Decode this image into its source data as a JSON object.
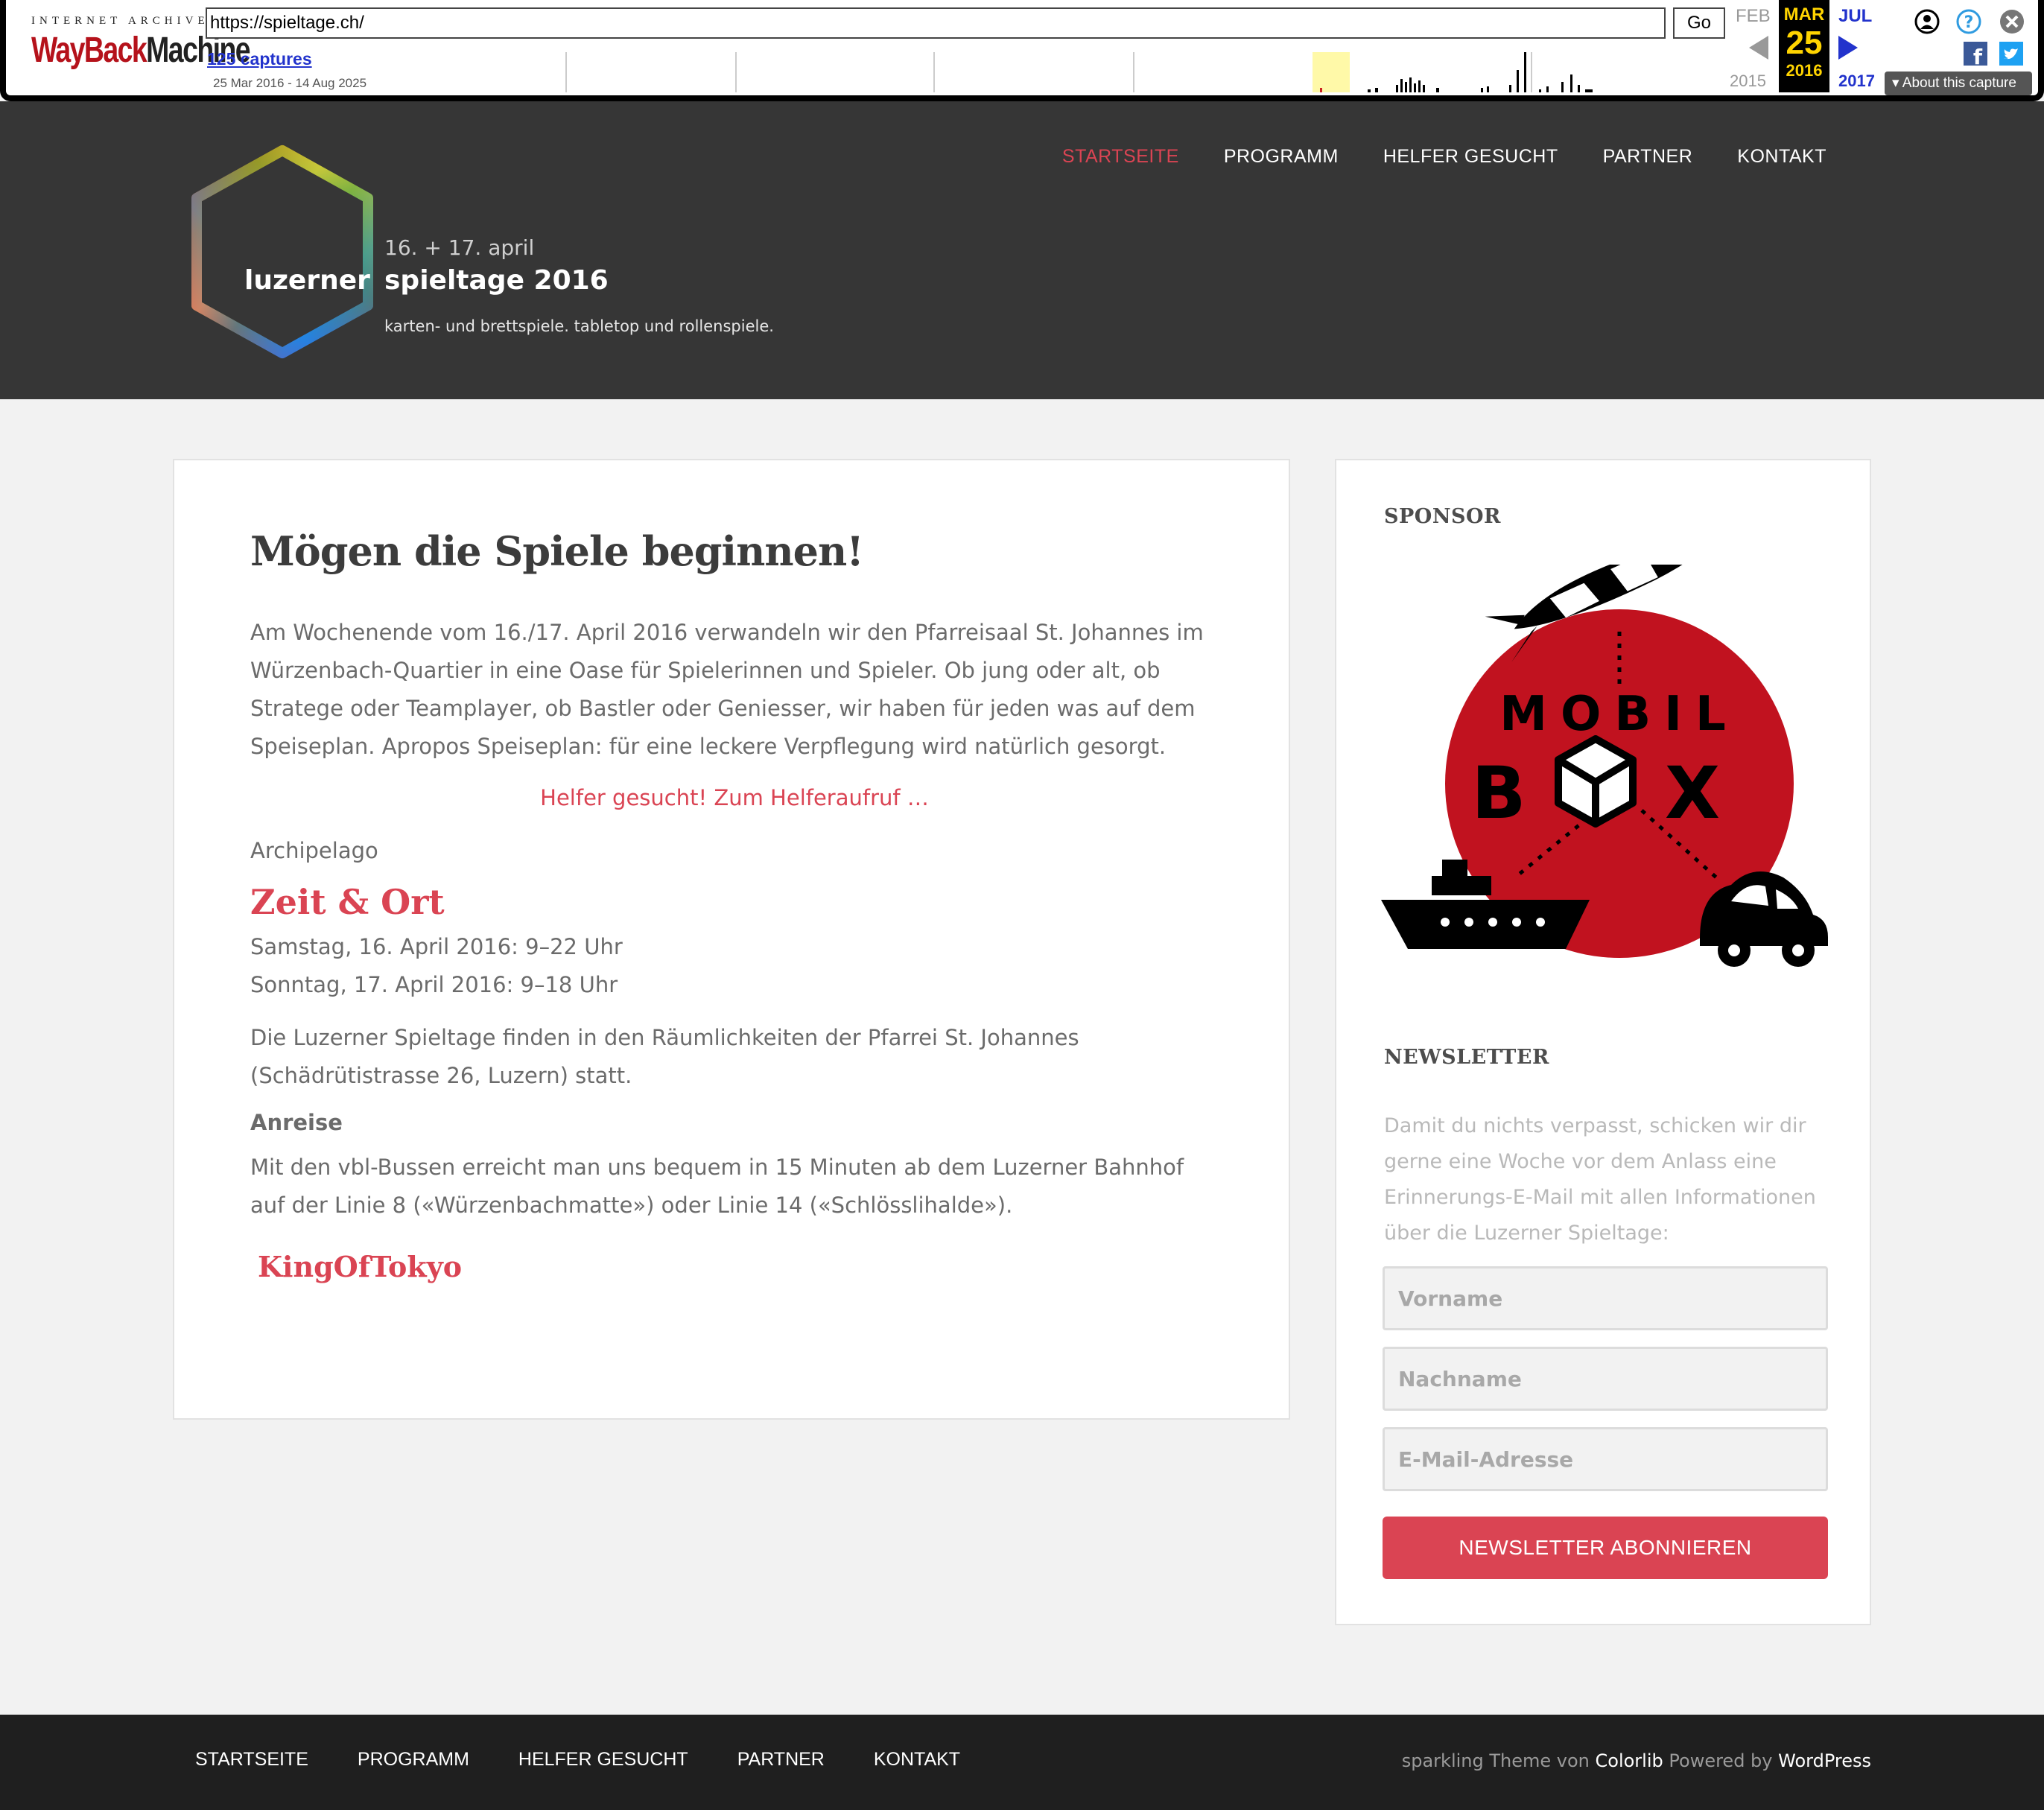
{
  "wayback": {
    "logo_top": "INTERNET ARCHIVE",
    "logo_way": "WayBack",
    "logo_machine": "Machine",
    "url": "https://spieltage.ch/",
    "go_label": "Go",
    "captures": "125 captures",
    "date_range": "25 Mar 2016 - 14 Aug 2025",
    "prev_month": "FEB",
    "cur_month": "MAR",
    "cur_day": "25",
    "cur_year": "2016",
    "next_month": "JUL",
    "prev_year": "2015",
    "next_year": "2017",
    "about": "About this capture",
    "icons": [
      "user-icon",
      "help-icon",
      "close-icon",
      "facebook-icon",
      "twitter-icon"
    ]
  },
  "header": {
    "logo": {
      "dates": "16. + 17. april",
      "word_left": "luzerner",
      "word_right": "spieltage 2016",
      "tagline": "karten- und brettspiele. tabletop und rollenspiele."
    },
    "nav": [
      "STARTSEITE",
      "PROGRAMM",
      "HELFER GESUCHT",
      "PARTNER",
      "KONTAKT"
    ],
    "active_index": 0
  },
  "main": {
    "title": "Mögen die Spiele beginnen!",
    "intro": "Am Wochenende vom 16./17. April 2016 verwandeln wir den Pfarreisaal St. Johannes im Würzenbach-Quartier in eine Oase für Spielerinnen und Spieler. Ob jung oder alt, ob Stratege oder Teamplayer, ob Bastler oder Geniesser, wir haben für jeden was auf dem Speiseplan. Apropos Speiseplan: für eine leckere Verpflegung wird natürlich gesorgt.",
    "helper_link": "Helfer gesucht! Zum Helferaufruf …",
    "archipelago": "Archipelago",
    "time_place_heading": "Zeit & Ort",
    "saturday": "Samstag, 16. April 2016: 9–22 Uhr",
    "sunday": "Sonntag, 17. April 2016: 9–18 Uhr",
    "location": "Die Luzerner Spieltage finden in den Räumlichkeiten der Pfarrei St. Johannes (Schädrütistrasse 26, Luzern) statt.",
    "travel_heading": "Anreise",
    "travel": "Mit den vbl-Bussen erreicht man uns bequem in 15 Minuten ab dem Luzerner Bahnhof auf der Linie 8 («Würzenbachmatte») oder Linie 14 («Schlösslihalde»).",
    "king": "KingOfTokyo"
  },
  "sidebar": {
    "sponsor_title": "SPONSOR",
    "sponsor_word1": "MOBIL",
    "sponsor_word2_left": "B",
    "sponsor_word2_right": "X",
    "newsletter_title": "NEWSLETTER",
    "newsletter_text": "Damit du nichts verpasst, schicken wir dir gerne eine Woche vor dem Anlass eine Erinnerungs-E-Mail mit allen Informationen über die Luzerner Spieltage:",
    "firstname_placeholder": "Vorname",
    "lastname_placeholder": "Nachname",
    "email_placeholder": "E-Mail-Adresse",
    "subscribe_label": "NEWSLETTER ABONNIEREN"
  },
  "footer": {
    "nav": [
      "STARTSEITE",
      "PROGRAMM",
      "HELFER GESUCHT",
      "PARTNER",
      "KONTAKT"
    ],
    "credit_theme": "sparkling Theme von",
    "credit_colorlib": "Colorlib",
    "credit_powered": "Powered by",
    "credit_wp": "WordPress"
  },
  "colors": {
    "accent": "#da4453",
    "header_bg": "#363636",
    "footer_bg": "#1f1f1f",
    "page_bg": "#f2f2f2",
    "sponsor_red": "#c1121f"
  }
}
